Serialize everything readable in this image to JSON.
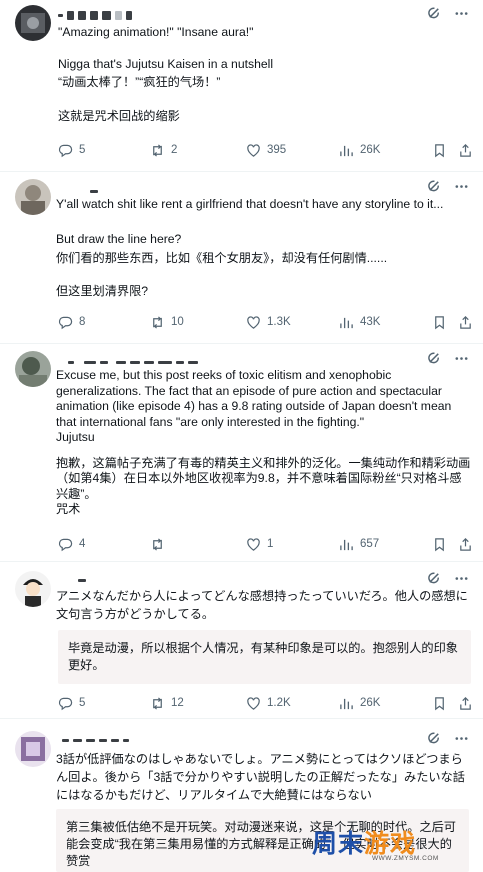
{
  "posts": [
    {
      "lines": [
        "\"Amazing animation!\" \"Insane aura!\"",
        "",
        "Nigga that's Jujutsu Kaisen in a nutshell",
        "“动画太棒了！”“疯狂的气场！”",
        "",
        "这就是咒术回战的缩影"
      ],
      "stats": {
        "replies": "5",
        "reposts": "2",
        "likes": "395",
        "views": "26K"
      }
    },
    {
      "lines": [
        "Y'all watch shit like rent a girlfriend that doesn't have any storyline to it...",
        "",
        "But draw the line here?",
        "你们看的那些东西，比如《租个女朋友》，却没有任何剧情......",
        "",
        "但这里划清界限?"
      ],
      "stats": {
        "replies": "8",
        "reposts": "10",
        "likes": "1.3K",
        "views": "43K"
      }
    },
    {
      "lines": [
        "Excuse me, but this post reeks of toxic elitism and xenophobic generalizations. The fact that an episode of pure action and spectacular animation (like episode 4) has a 9.8 rating outside of Japan doesn't mean that international fans \"are only interested in the fighting.\"",
        "Jujutsu",
        "",
        "抱歉，这篇帖子充满了有毒的精英主义和排外的泛化。一集纯动作和精彩动画（如第4集）在日本以外地区收视率为9.8，并不意味着国际粉丝“只对格斗感兴趣”。",
        "咒术"
      ],
      "stats": {
        "replies": "4",
        "reposts": "",
        "likes": "1",
        "views": "657"
      }
    },
    {
      "lines": [
        "アニメなんだから人によってどんな感想持ったっていいだろ。他人の感想に文句言う方がどうかしてる。"
      ],
      "translation": "毕竟是动漫，所以根据个人情况，有某种印象是可以的。抱怨别人的印象更好。",
      "stats": {
        "replies": "5",
        "reposts": "12",
        "likes": "1.2K",
        "views": "26K"
      }
    },
    {
      "lines": [
        "3話が低評価なのはしゃあないでしょ。アニメ勢にとってはクソほどつまらん回よ。後から「3話で分かりやすい説明したの正解だったな」みたいな話にはなるかもだけど、リアルタイムで大絶賛にはならない"
      ],
      "translation": "第三集被低估绝不是开玩笑。对动漫迷来说，这是个无聊的时代。之后可能会变成“我在第三集用易懂的方式解释是正确的”，但实时不会是很大的赞赏"
    }
  ],
  "watermark": {
    "brand_a": "周末",
    "brand_b": "游戏",
    "url": "WWW.ZMYSM.COM"
  },
  "colors": {
    "text": "#0f1419",
    "muted": "#536471",
    "divider": "#eff3f4",
    "quote_bg": "#f7f3f3"
  }
}
